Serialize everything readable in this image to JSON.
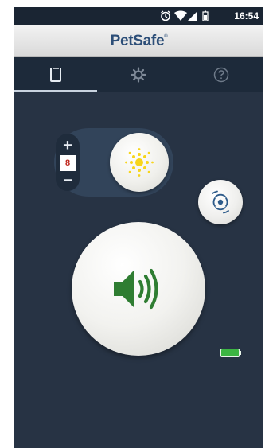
{
  "status_bar": {
    "time": "16:54",
    "icons": [
      "alarm-icon",
      "wifi-icon",
      "signal-icon",
      "battery-icon"
    ]
  },
  "app_bar": {
    "title": "PetSafe",
    "trademark": "®"
  },
  "tabs": [
    {
      "name": "remote",
      "icon": "collar-remote-icon",
      "active": true
    },
    {
      "name": "settings",
      "icon": "gear-icon",
      "active": false
    },
    {
      "name": "help",
      "icon": "help-icon",
      "active": false
    }
  ],
  "controls": {
    "light_level": {
      "increment_label": "+",
      "decrement_label": "−",
      "value": "8"
    },
    "light_button_icon": "light-burst-icon",
    "vibrate_button_icon": "vibrate-icon",
    "tone_button_icon": "speaker-icon",
    "collar_battery_icon": "battery-full-icon"
  },
  "colors": {
    "background": "#273344",
    "title": "#2c4e78",
    "light_icon": "#f7d51c",
    "tone_icon": "#2f7d32",
    "battery": "#3cb543",
    "level_value": "#c0281e"
  }
}
